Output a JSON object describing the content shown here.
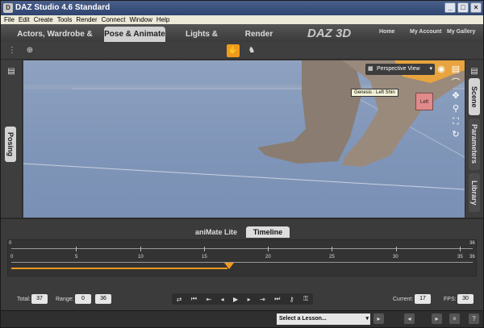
{
  "window": {
    "title": "DAZ Studio 4.6 Standard"
  },
  "menu": [
    "File",
    "Edit",
    "Create",
    "Tools",
    "Render",
    "Connect",
    "Window",
    "Help"
  ],
  "tabs": [
    {
      "label": "Actors, Wardrobe & Props",
      "active": false
    },
    {
      "label": "Pose & Animate",
      "active": true
    },
    {
      "label": "Lights & Cameras",
      "active": false
    },
    {
      "label": "Render",
      "active": false
    }
  ],
  "brand": {
    "logo": "DAZ 3D"
  },
  "top_links": [
    "Home",
    "My Account",
    "My Gallery"
  ],
  "left_pane": {
    "tab": "Posing"
  },
  "right_pane": {
    "tabs": [
      "Scene",
      "Parameters",
      "Library"
    ]
  },
  "viewport": {
    "view_selector": "Perspective View",
    "tooltip": "Genesis : Left Shin",
    "cube_label": "Left"
  },
  "animate": {
    "tabs": [
      {
        "label": "aniMate Lite",
        "active": false
      },
      {
        "label": "Timeline",
        "active": true
      }
    ],
    "ruler_top": [
      "0",
      "36"
    ],
    "ruler_ticks": [
      "0",
      "5",
      "10",
      "15",
      "20",
      "25",
      "30",
      "35",
      "36"
    ],
    "total_label": "Total:",
    "total_value": "37",
    "range_label": "Range:",
    "range_start": "0",
    "range_end": "36",
    "current_label": "Current:",
    "current_value": "17",
    "fps_label": "FPS:",
    "fps_value": "30"
  },
  "status": {
    "lesson_placeholder": "Select a Lesson..."
  },
  "colors": {
    "accent": "#f29a1a",
    "viewport_bg": "#8ea1c0",
    "active_tab": "#d0d0d0"
  }
}
